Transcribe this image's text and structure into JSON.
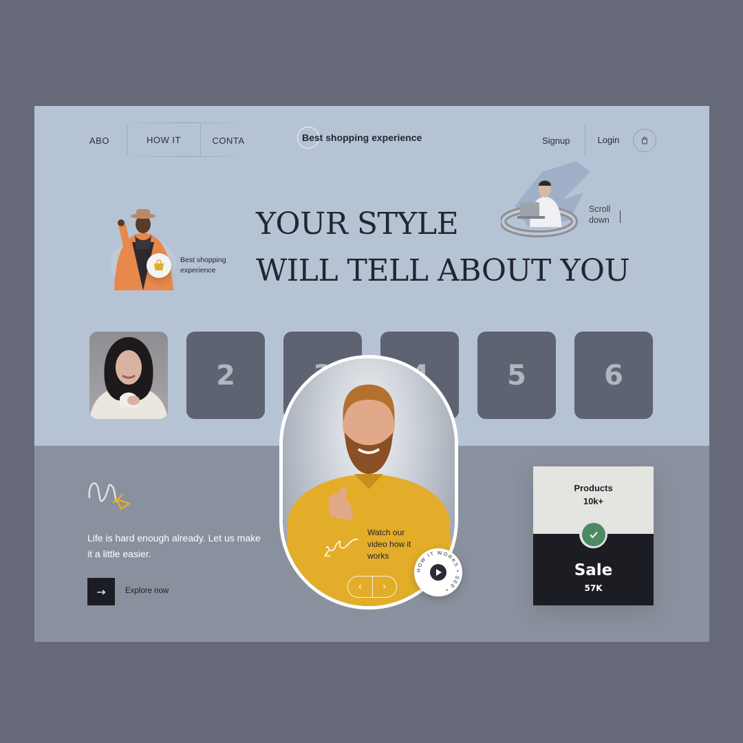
{
  "nav": {
    "items": [
      {
        "label": "ABO"
      },
      {
        "label": "HOW IT"
      },
      {
        "label": "CONTA"
      }
    ],
    "brand": "Best shopping experience",
    "signup": "Signup",
    "login": "Login",
    "cart_icon": "shopping-bag-icon"
  },
  "hero": {
    "title_line1": "YOUR STYLE",
    "title_line2": "WILL TELL ABOUT YOU",
    "caption": "Best shopping experience",
    "scroll_label": "Scroll down"
  },
  "tiles": [
    {
      "label": "2"
    },
    {
      "label": "3"
    },
    {
      "label": "4"
    },
    {
      "label": "5"
    },
    {
      "label": "6"
    }
  ],
  "video": {
    "caption": "Watch our video how it works",
    "badge_text": "HOW IT WORKS • SEE •",
    "prev_icon": "chevron-left-icon",
    "next_icon": "chevron-right-icon",
    "play_icon": "play-icon"
  },
  "promo": {
    "tagline": "Life is hard enough already. Let us make it a little easier.",
    "explore_label": "Explore now",
    "explore_icon": "arrow-right-icon"
  },
  "stats_card": {
    "products_label": "Products",
    "products_value": "10k+",
    "sale_label": "Sale",
    "sale_value": "57K"
  },
  "colors": {
    "page_bg": "#666a78",
    "canvas_bg": "#b6c3d4",
    "bottom_bg": "#8a919e",
    "tile_bg": "#5d6370",
    "accent_yellow": "#e3ad2a",
    "check_green": "#4c8a63"
  }
}
